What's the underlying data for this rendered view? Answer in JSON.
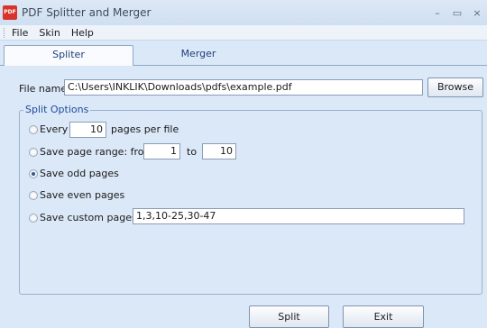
{
  "window": {
    "title": "PDF Splitter and Merger",
    "icon_text": "PDF",
    "minimize_glyph": "–",
    "maximize_glyph": "▭",
    "close_glyph": "×"
  },
  "menu": {
    "items": [
      {
        "label": "File"
      },
      {
        "label": "Skin"
      },
      {
        "label": "Help"
      }
    ]
  },
  "tabs": [
    {
      "label": "Spliter",
      "active": true
    },
    {
      "label": "Merger",
      "active": false
    }
  ],
  "file": {
    "label": "File name:",
    "value": "C:\\Users\\INKLIK\\Downloads\\pdfs\\example.pdf",
    "browse_label": "Browse"
  },
  "split_options": {
    "title": "Split Options",
    "every": {
      "label": "Every",
      "value": "10",
      "suffix": "pages per file"
    },
    "range": {
      "label": "Save page range: from",
      "from": "1",
      "to_label": "to",
      "to": "10"
    },
    "odd": {
      "label": "Save odd pages",
      "selected": true
    },
    "even": {
      "label": "Save even pages"
    },
    "custom": {
      "label": "Save custom pages:",
      "value": "1,3,10-25,30-47"
    }
  },
  "actions": {
    "split_label": "Split",
    "exit_label": "Exit"
  }
}
